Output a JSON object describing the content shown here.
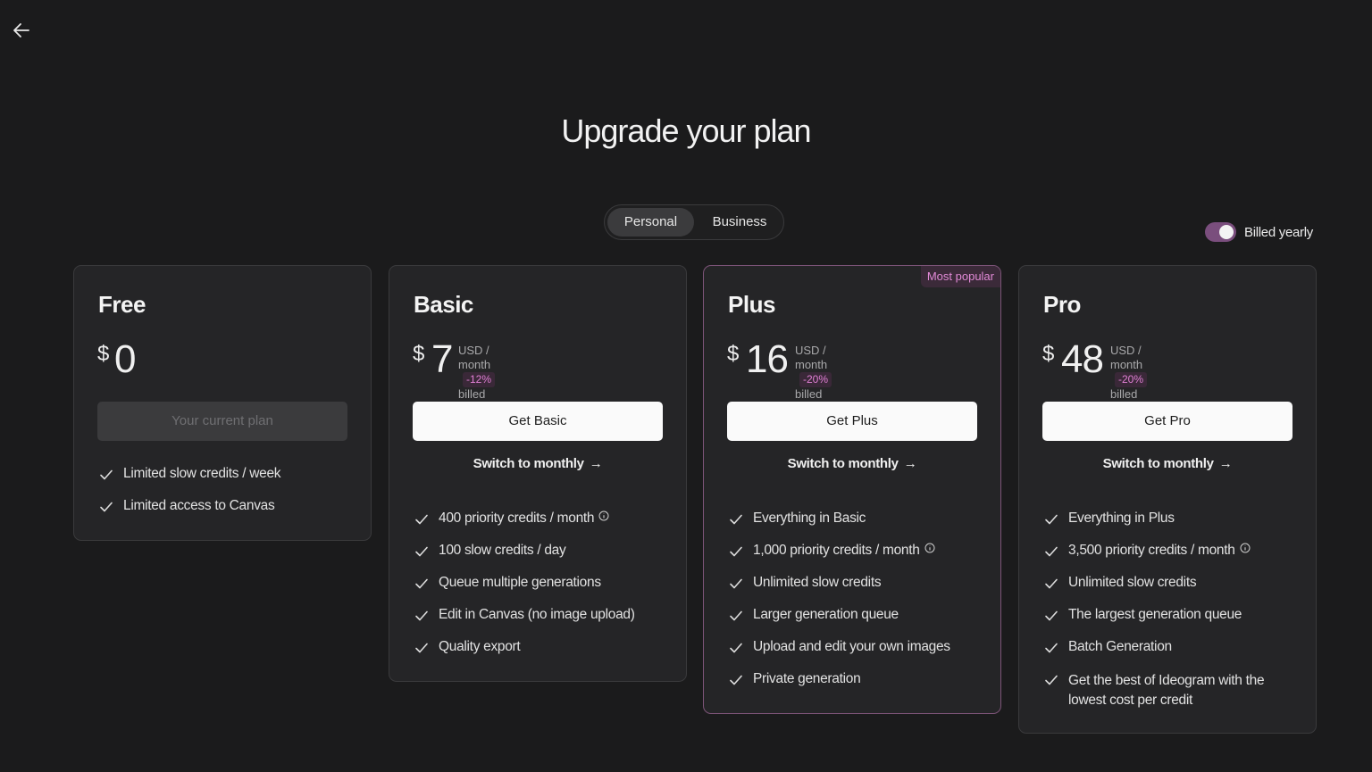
{
  "header": {
    "title": "Upgrade your plan"
  },
  "tabs": {
    "personal": "Personal",
    "business": "Business"
  },
  "billing": {
    "label": "Billed yearly",
    "toggle_on": true
  },
  "colors": {
    "accent": "#e07fd4",
    "toggle": "#7a4e7d",
    "background": "#1b1b1c",
    "card": "#252527"
  },
  "plans": [
    {
      "name": "Free",
      "currency": "$",
      "price": "0",
      "button": "Your current plan",
      "features": [
        "Limited slow credits / week",
        "Limited access to Canvas"
      ]
    },
    {
      "name": "Basic",
      "currency": "$",
      "price": "7",
      "period": "USD / month",
      "billed": "billed yearly",
      "discount": "-12%",
      "button": "Get Basic",
      "switch": "Switch to monthly",
      "features": [
        "400 priority credits / month",
        "100 slow credits / day",
        "Queue multiple generations",
        "Edit in Canvas (no image upload)",
        "Quality export"
      ]
    },
    {
      "name": "Plus",
      "badge": "Most popular",
      "currency": "$",
      "price": "16",
      "period": "USD / month",
      "billed": "billed yearly",
      "discount": "-20%",
      "button": "Get Plus",
      "switch": "Switch to monthly",
      "features": [
        "Everything in Basic",
        "1,000 priority credits / month",
        "Unlimited slow credits",
        "Larger generation queue",
        "Upload and edit your own images",
        "Private generation"
      ]
    },
    {
      "name": "Pro",
      "currency": "$",
      "price": "48",
      "period": "USD / month",
      "billed": "billed yearly",
      "discount": "-20%",
      "button": "Get Pro",
      "switch": "Switch to monthly",
      "features": [
        "Everything in Plus",
        "3,500 priority credits / month",
        "Unlimited slow credits",
        "The largest generation queue",
        "Batch Generation",
        "Get the best of Ideogram with the lowest cost per credit"
      ]
    }
  ]
}
